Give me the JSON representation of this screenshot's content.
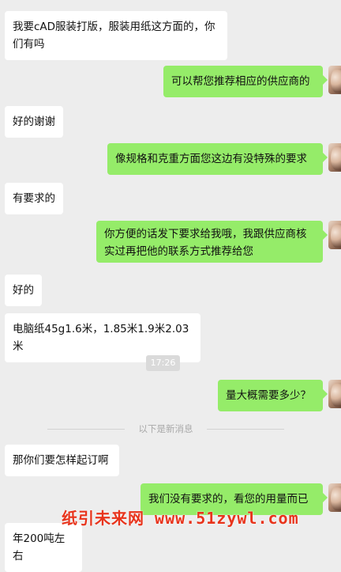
{
  "messages": [
    {
      "side": "in",
      "text": "我要cAD服装打版，服装用纸这方面的，你们有吗"
    },
    {
      "side": "out",
      "text": "可以帮您推荐相应的供应商的"
    },
    {
      "side": "in",
      "text": "好的谢谢"
    },
    {
      "side": "out",
      "text": "像规格和克重方面您这边有没特殊的要求"
    },
    {
      "side": "in",
      "text": "有要求的"
    },
    {
      "side": "out",
      "text": "你方便的话发下要求给我哦，我跟供应商核实过再把他的联系方式推荐给您"
    },
    {
      "side": "in",
      "text": "好的"
    },
    {
      "side": "in",
      "text": "电脑纸45g1.6米，1.85米1.9米2.03米"
    },
    {
      "side": "out",
      "text": "量大概需要多少？"
    },
    {
      "side": "in",
      "text": "那你们要怎样起订啊"
    },
    {
      "side": "out",
      "text": "我们没有要求的，看您的用量而已"
    },
    {
      "side": "in",
      "text": "年200吨左右"
    }
  ],
  "timestamp": "17:26",
  "new_messages_divider": "以下是新消息",
  "watermark": "纸引未来网 www.51zywl.com",
  "colors": {
    "background": "#ededed",
    "incoming_bubble": "#ffffff",
    "outgoing_bubble": "#95ec69",
    "watermark": "#e8341c"
  }
}
